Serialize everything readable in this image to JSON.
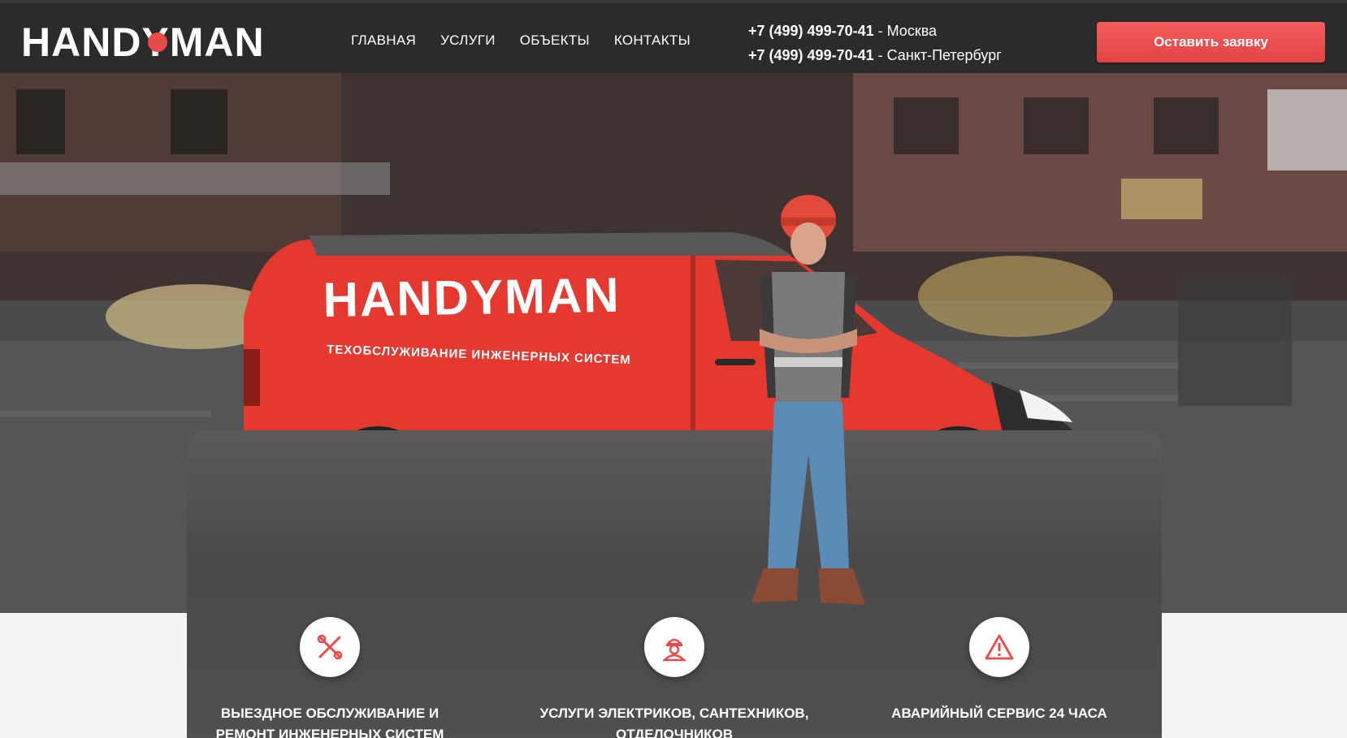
{
  "header": {
    "logo_text": "HANDYMAN",
    "nav": [
      {
        "label": "ГЛАВНАЯ"
      },
      {
        "label": "УСЛУГИ"
      },
      {
        "label": "ОБЪЕКТЫ"
      },
      {
        "label": "КОНТАКТЫ"
      }
    ],
    "phones": [
      {
        "number": "+7 (499) 499-70-41",
        "city": " - Москва"
      },
      {
        "number": "+7 (499) 499-70-41",
        "city": " - Санкт-Петербург"
      }
    ],
    "cta_label": "Оставить заявку"
  },
  "hero": {
    "van_logo": "HANDYMAN",
    "van_subtitle": "ТЕХОБСЛУЖИВАНИЕ ИНЖЕНЕРНЫХ СИСТЕМ"
  },
  "features": [
    {
      "icon": "tools-icon",
      "title": "ВЫЕЗДНОЕ ОБСЛУЖИВАНИЕ И РЕМОНТ ИНЖЕНЕРНЫХ СИСТЕМ"
    },
    {
      "icon": "worker-icon",
      "title": "УСЛУГИ ЭЛЕКТРИКОВ, САНТЕХНИКОВ, ОТДЕЛОЧНИКОВ"
    },
    {
      "icon": "warning-icon",
      "title": "АВАРИЙНЫЙ СЕРВИС 24 ЧАСА"
    }
  ],
  "colors": {
    "accent": "#e94b4b",
    "header_bg": "#2b2b2b",
    "van_red": "#e5392f"
  }
}
